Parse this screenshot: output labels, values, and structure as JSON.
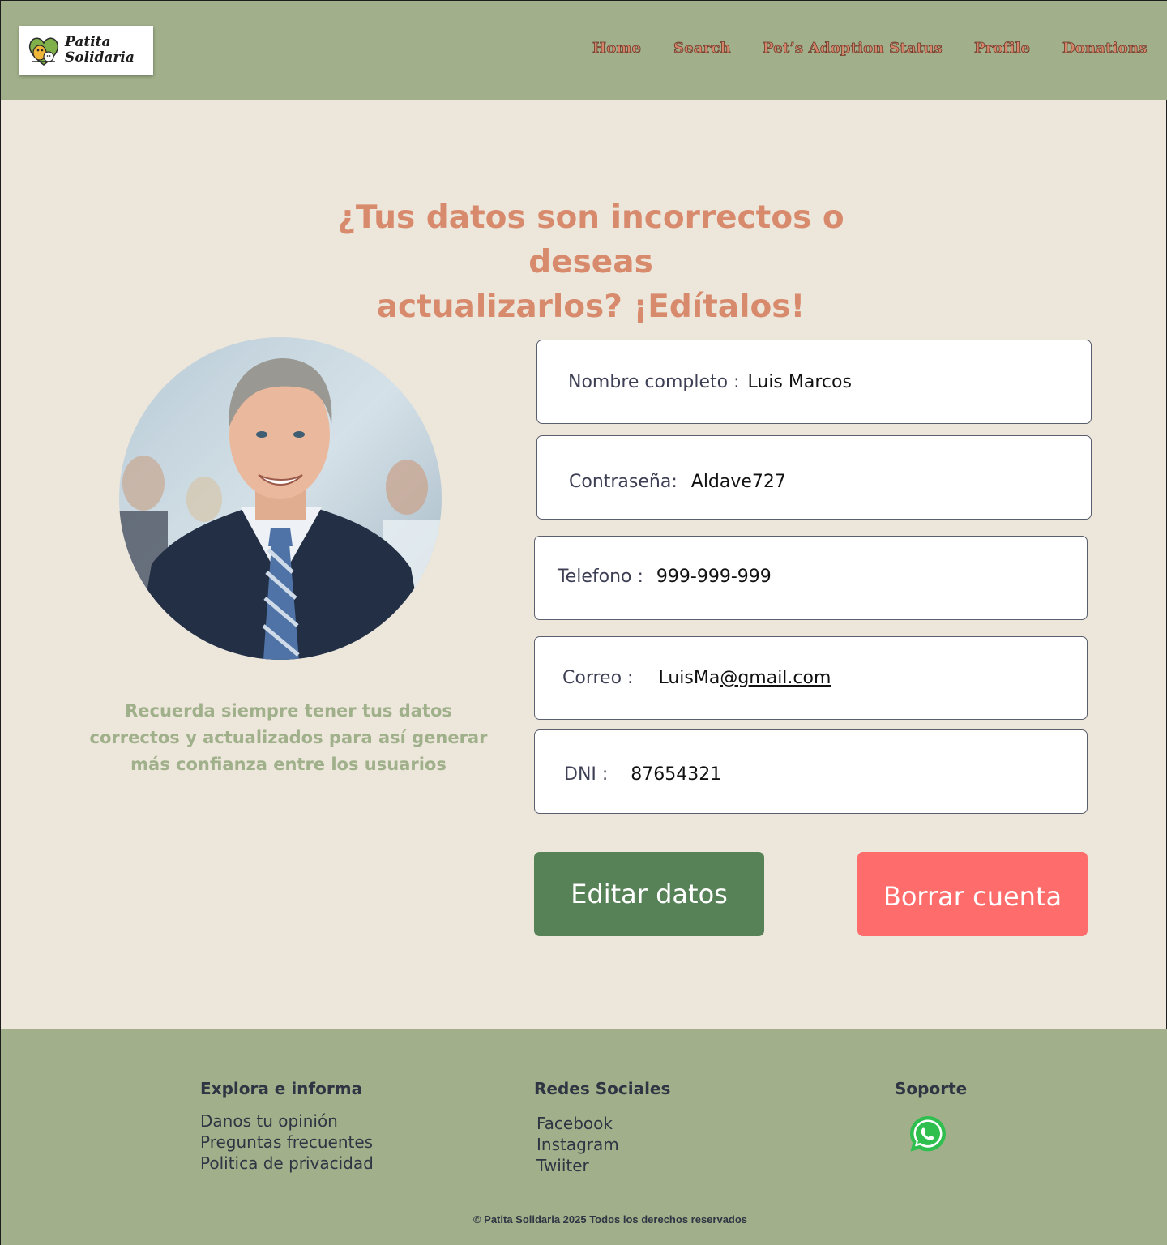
{
  "header": {
    "logo": {
      "line1": "Patita",
      "line2": "Solidaria"
    },
    "nav": [
      {
        "label": "Home"
      },
      {
        "label": "Search"
      },
      {
        "label": "Pet’s Adoption Status"
      },
      {
        "label": "Profile"
      },
      {
        "label": "Donations"
      }
    ]
  },
  "main": {
    "title_line1": "¿Tus datos son incorrectos o deseas",
    "title_line2": "actualizarlos? ¡Edítalos!",
    "reminder": "Recuerda siempre tener tus datos correctos y actualizados para así generar más confianza entre los usuarios",
    "fields": {
      "name": {
        "label": "Nombre completo :",
        "value": "Luis Marcos"
      },
      "password": {
        "label": "Contraseña:",
        "value": "Aldave727"
      },
      "phone": {
        "label": "Telefono :",
        "value": "999-999-999"
      },
      "email": {
        "label": "Correo :",
        "value_user": "LuisMa",
        "value_domain": "@gmail.com"
      },
      "dni": {
        "label": "DNI :",
        "value": "87654321"
      }
    },
    "buttons": {
      "edit": "Editar datos",
      "delete": "Borrar cuenta"
    }
  },
  "footer": {
    "explore": {
      "heading": "Explora e informa",
      "links": [
        "Danos tu opinión",
        "Preguntas frecuentes",
        "Politica de privacidad"
      ]
    },
    "social": {
      "heading": "Redes Sociales",
      "links": [
        "Facebook",
        "Instagram",
        "Twiiter"
      ]
    },
    "support": {
      "heading": "Soporte",
      "icon": "whatsapp-icon"
    },
    "copyright": "© Patita Solidaria 2025 Todos los derechos reservados"
  },
  "colors": {
    "header_bg": "#a1b08a",
    "page_bg": "#ede6db",
    "title": "#d88a6d",
    "edit_button": "#578257",
    "delete_button": "#fe6c6c"
  }
}
